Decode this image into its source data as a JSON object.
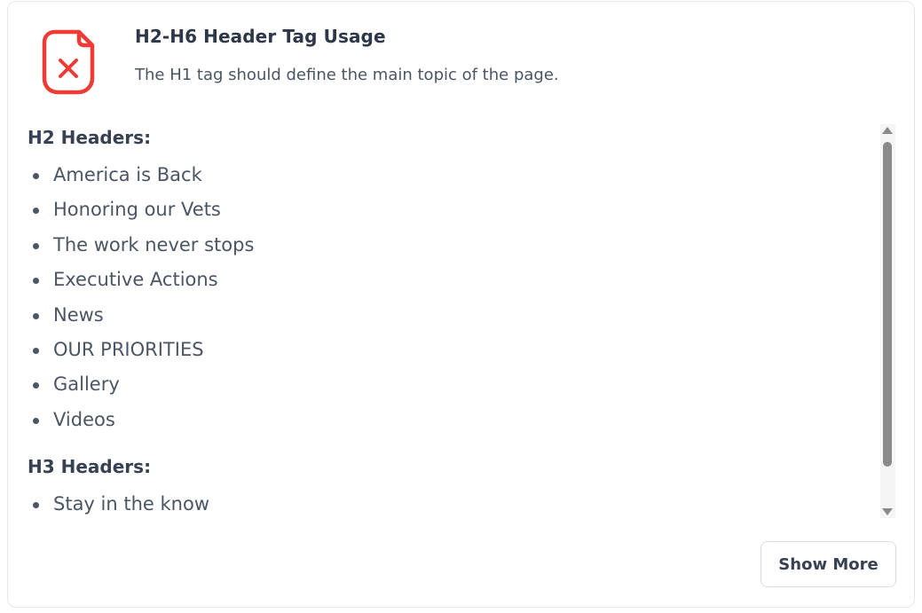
{
  "audit": {
    "title": "H2-H6 Header Tag Usage",
    "description": "The H1 tag should define the main topic of the page.",
    "status": "fail",
    "status_icon": "document-x-icon",
    "status_color": "#ef3b36"
  },
  "sections": [
    {
      "heading": "H2 Headers:",
      "items": [
        "America is Back",
        "Honoring our Vets",
        "The work never stops",
        "Executive Actions",
        "News",
        "OUR PRIORITIES",
        "Gallery",
        "Videos"
      ]
    },
    {
      "heading": "H3 Headers:",
      "items": [
        "Stay in the know"
      ]
    }
  ],
  "actions": {
    "show_more_label": "Show More"
  }
}
